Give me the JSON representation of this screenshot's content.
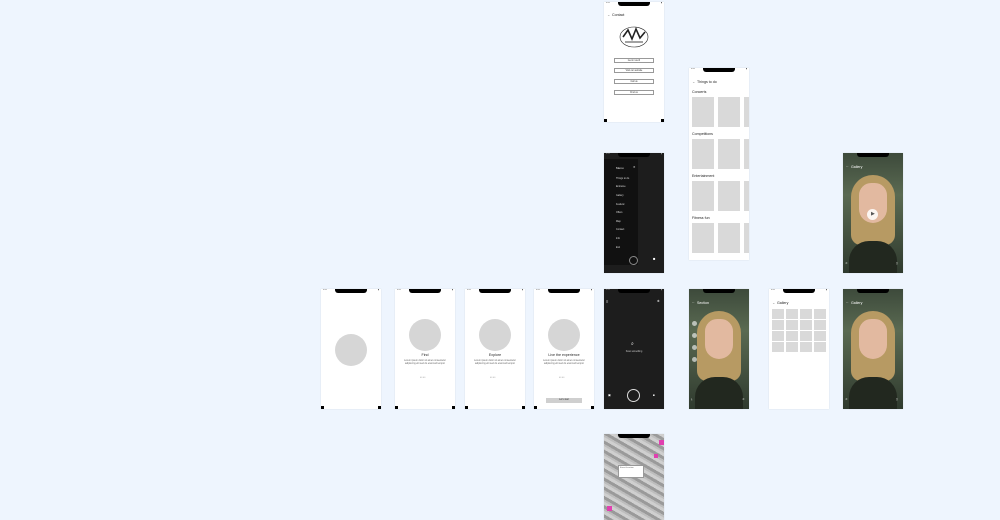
{
  "status_time": "9:41",
  "contact": {
    "title": "Contact",
    "buttons": [
      "Get in touch",
      "Visit our website",
      "Call us",
      "Find us"
    ]
  },
  "things": {
    "title": "Things to do",
    "sections": [
      "Concerts",
      "Competitions",
      "Entertainment",
      "Fitness fun"
    ]
  },
  "menu": {
    "title": "Menu",
    "items": [
      "Things to do",
      "Entrance",
      "Gallery",
      "Festival",
      "Offers",
      "Map",
      "Contact",
      "Info",
      "Exit"
    ]
  },
  "gallery": {
    "title": "Gallery"
  },
  "section": {
    "title": "Section"
  },
  "onboarding": [
    {
      "title": "",
      "body": ""
    },
    {
      "title": "Find",
      "body": "Lorem ipsum dolor sit amet consectetur adipiscing elit sed do eiusmod tempor"
    },
    {
      "title": "Explore",
      "body": "Lorem ipsum dolor sit amet consectetur adipiscing elit sed do eiusmod tempor"
    },
    {
      "title": "Live the experience",
      "body": "Lorem ipsum dolor sit amet consectetur adipiscing elit sed do eiusmod tempor",
      "button": "Let's start"
    }
  ],
  "camera": {
    "hint": "Scan something"
  },
  "map": {
    "popup": "Event location"
  }
}
